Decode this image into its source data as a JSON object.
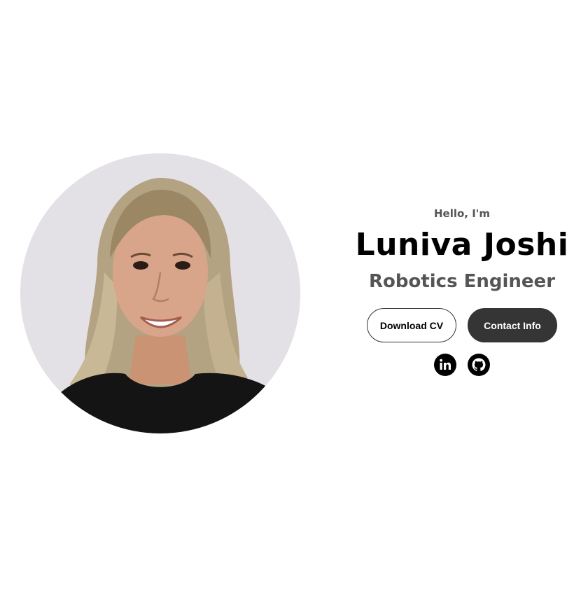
{
  "hero": {
    "greeting": "Hello, I'm",
    "name": "Luniva Joshi",
    "title": "Robotics Engineer",
    "profile_alt": "Luniva Joshi profile picture"
  },
  "buttons": {
    "download_cv": "Download CV",
    "contact_info": "Contact Info"
  },
  "socials": [
    {
      "icon": "linkedin-icon",
      "label": "LinkedIn"
    },
    {
      "icon": "github-icon",
      "label": "GitHub"
    }
  ],
  "colors": {
    "text_primary": "#000000",
    "text_secondary": "#555555",
    "button_dark": "#353535",
    "background": "#ffffff"
  }
}
